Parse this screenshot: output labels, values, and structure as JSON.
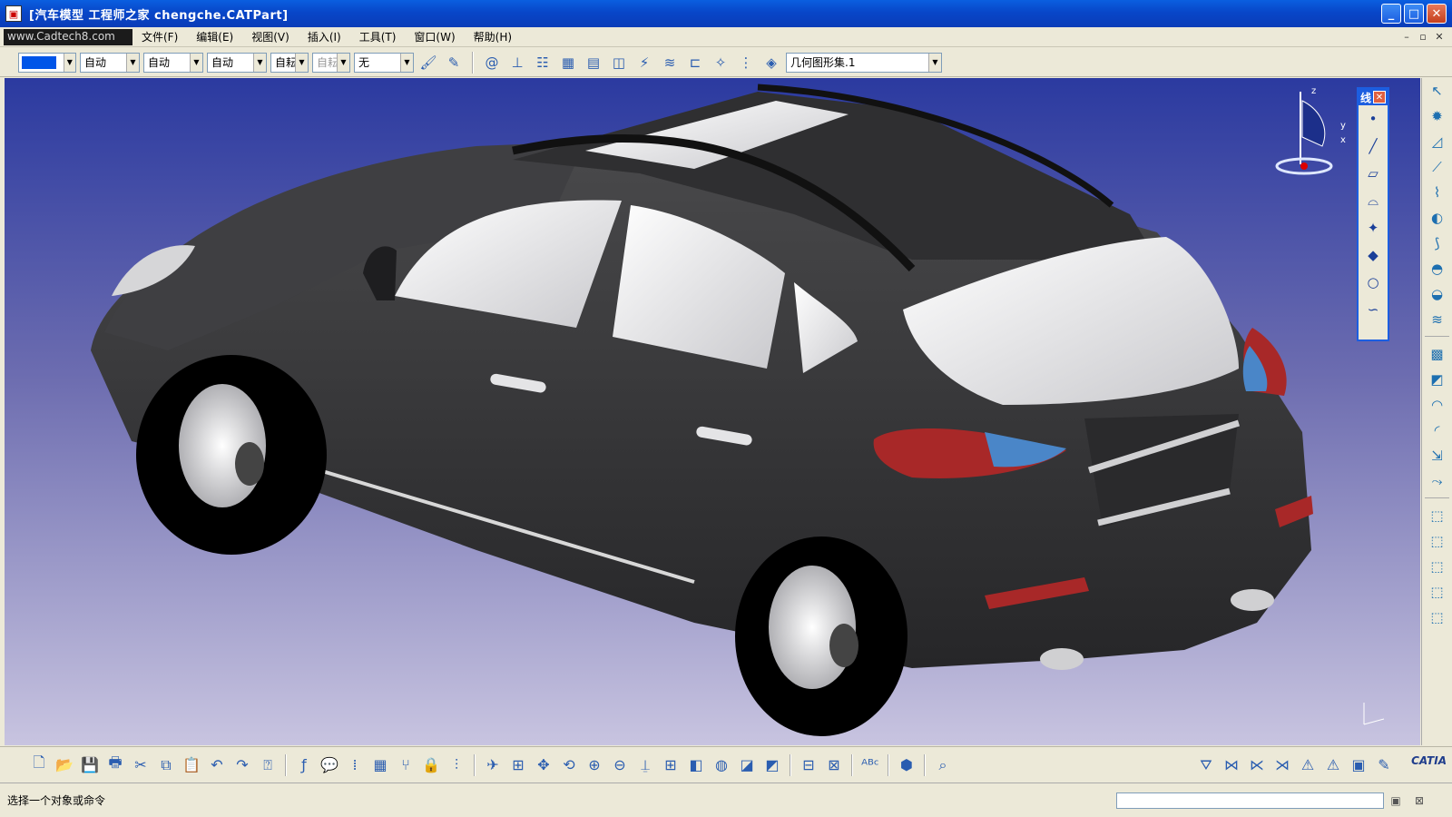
{
  "window": {
    "title": "[汽车模型 工程师之家 chengche.CATPart]",
    "icon": "catia-doc-icon",
    "min_label": "_",
    "max_label": "□",
    "close_label": "✕"
  },
  "menubar": {
    "watermark": "www.Cadtech8.com",
    "items": [
      {
        "label": "文件(F)"
      },
      {
        "label": "编辑(E)"
      },
      {
        "label": "视图(V)"
      },
      {
        "label": "插入(I)"
      },
      {
        "label": "工具(T)"
      },
      {
        "label": "窗口(W)"
      },
      {
        "label": "帮助(H)"
      }
    ],
    "doc_buttons": [
      "–",
      "▫",
      "✕"
    ]
  },
  "toolbar_top": {
    "color_value": "#0055e8",
    "combos": [
      {
        "value": "自动"
      },
      {
        "value": "自动"
      },
      {
        "value": "自动"
      },
      {
        "value": "自耘"
      },
      {
        "value": "自耘",
        "disabled": true
      },
      {
        "value": "无"
      }
    ],
    "geoset": {
      "value": "几何图形集.1"
    }
  },
  "float_toolbar": {
    "title": "线",
    "close_label": "✕"
  },
  "statusbar": {
    "message": "选择一个对象或命令"
  },
  "brand": {
    "logo_text": "CATIA",
    "accent": "#1c5ee0",
    "car_body": "#3a3a3c",
    "taillight": "#a82828",
    "light_blue": "#4a86c8"
  },
  "compass": {
    "axis_z": "z",
    "axis_y": "y",
    "axis_x": "x"
  }
}
